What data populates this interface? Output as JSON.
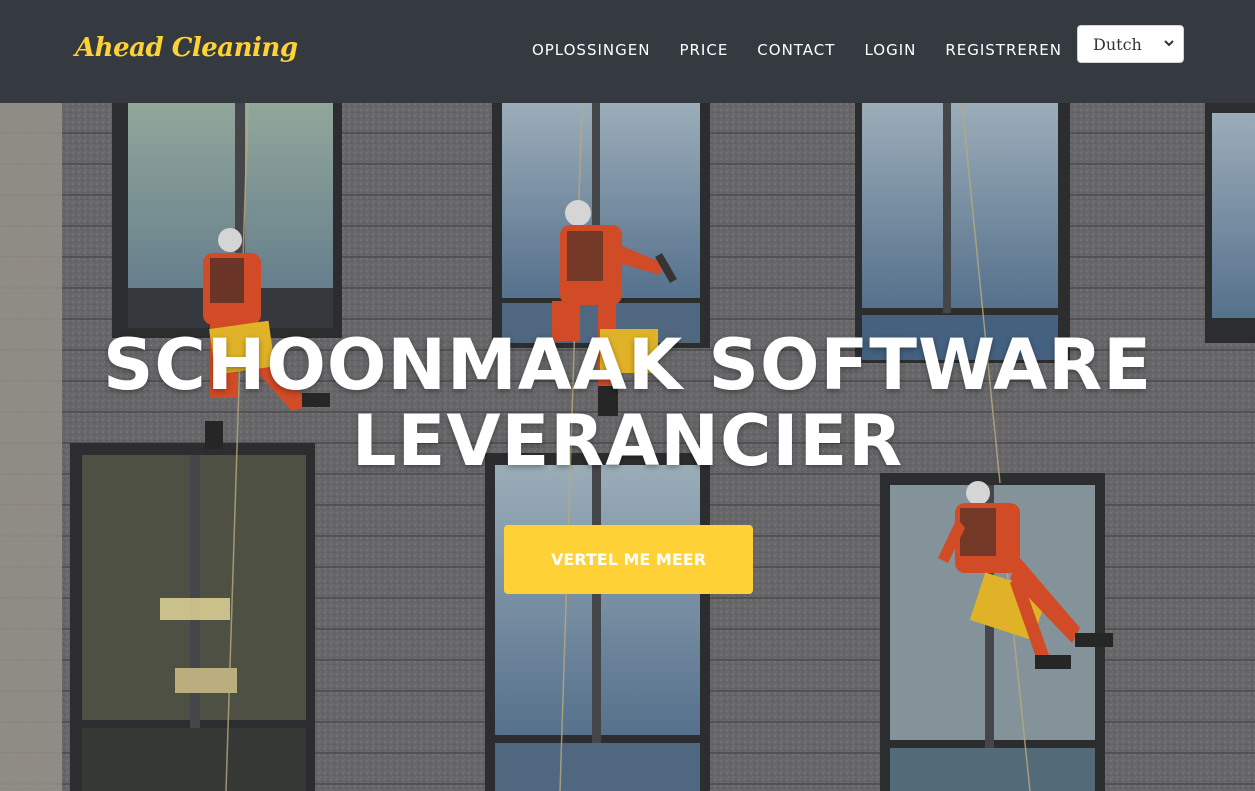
{
  "brand": "Ahead Cleaning",
  "nav": {
    "items": [
      {
        "label": "OPLOSSINGEN"
      },
      {
        "label": "PRICE"
      },
      {
        "label": "CONTACT"
      },
      {
        "label": "LOGIN"
      },
      {
        "label": "REGISTREREN"
      }
    ]
  },
  "language": {
    "selected": "Dutch"
  },
  "hero": {
    "line1": "SCHOONMAAK SOFTWARE",
    "line2": "LEVERANCIER",
    "cta": "VERTEL ME MEER"
  },
  "colors": {
    "navbar": "#343a40",
    "accent": "#fed136",
    "text": "#ffffff"
  }
}
